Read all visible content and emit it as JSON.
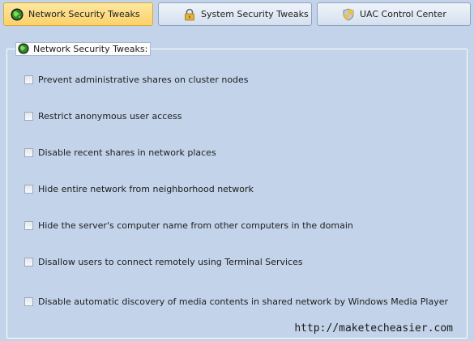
{
  "tabs": [
    {
      "label": "Network Security Tweaks",
      "icon": "globe-icon",
      "active": true
    },
    {
      "label": "System Security Tweaks",
      "icon": "padlock-icon",
      "active": false
    },
    {
      "label": "UAC Control Center",
      "icon": "shield-icon",
      "active": false
    }
  ],
  "group": {
    "title": "Network Security Tweaks:",
    "icon": "globe-icon"
  },
  "options": [
    {
      "label": "Prevent administrative shares on cluster nodes",
      "checked": false
    },
    {
      "label": "Restrict anonymous user access",
      "checked": false
    },
    {
      "label": "Disable recent shares in network places",
      "checked": false
    },
    {
      "label": "Hide entire network from neighborhood network",
      "checked": false
    },
    {
      "label": "Hide the server's computer name from other computers in the domain",
      "checked": false
    },
    {
      "label": "Disallow users to connect remotely using Terminal Services",
      "checked": false
    },
    {
      "label": "Disable automatic discovery of media contents in shared network by Windows Media Player",
      "checked": false
    }
  ],
  "watermark": "http://maketecheasier.com",
  "colors": {
    "background": "#c2d3ea",
    "active_tab": "#fbd26a",
    "tab": "#dde6f2"
  }
}
